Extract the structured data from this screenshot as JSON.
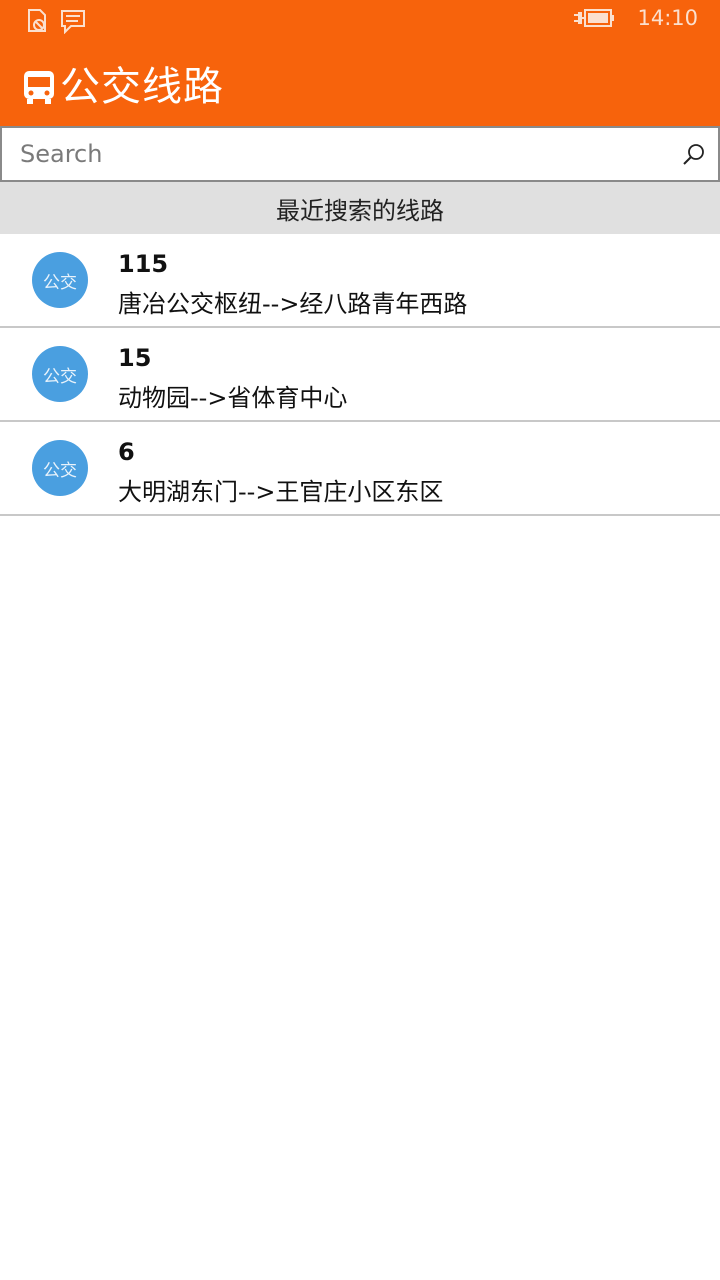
{
  "status_bar": {
    "time": "14:10",
    "icons": [
      "battery-saver-icon",
      "message-icon",
      "charging-battery-icon"
    ]
  },
  "header": {
    "icon": "bus-icon",
    "title": "公交线路"
  },
  "search": {
    "placeholder": "Search",
    "value": "",
    "icon": "search-icon"
  },
  "recent": {
    "title": "最近搜索的线路",
    "items": [
      {
        "badge": "公交",
        "number": "115",
        "route": "唐冶公交枢纽-->经八路青年西路"
      },
      {
        "badge": "公交",
        "number": "15",
        "route": "动物园-->省体育中心"
      },
      {
        "badge": "公交",
        "number": "6",
        "route": "大明湖东门-->王官庄小区东区"
      }
    ]
  },
  "colors": {
    "accent": "#f7630c",
    "badge": "#4a9fe0",
    "section_bg": "#e0e0e0",
    "divider": "#c8c8c8"
  }
}
